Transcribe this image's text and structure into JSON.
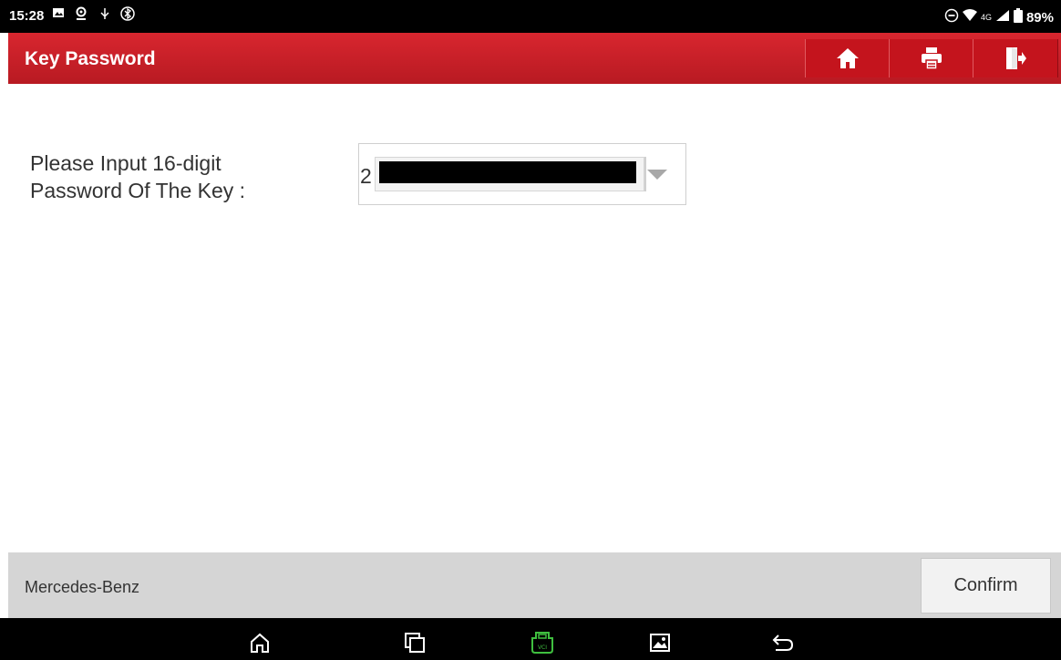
{
  "status_bar": {
    "time": "15:28",
    "network": "4G",
    "battery": "89%",
    "icons": [
      "image-icon",
      "location-icon",
      "usb-icon",
      "bluetooth-icon",
      "dnd-icon",
      "wifi-icon",
      "signal-icon",
      "battery-icon"
    ]
  },
  "header": {
    "title": "Key Password",
    "buttons": [
      "home-icon",
      "print-icon",
      "exit-icon"
    ]
  },
  "form": {
    "prompt_line1": "Please Input 16-digit",
    "prompt_line2": "Password Of The Key :",
    "value_prefix": "2"
  },
  "footer": {
    "brand": "Mercedes-Benz",
    "confirm_label": "Confirm"
  },
  "navbar": {
    "icons": [
      "home-nav-icon",
      "recents-icon",
      "vci-icon",
      "screenshot-icon",
      "back-icon"
    ],
    "vci_color": "#3fbf3f"
  },
  "colors": {
    "header_red": "#c8202a",
    "footer_gray": "#d5d5d5"
  }
}
